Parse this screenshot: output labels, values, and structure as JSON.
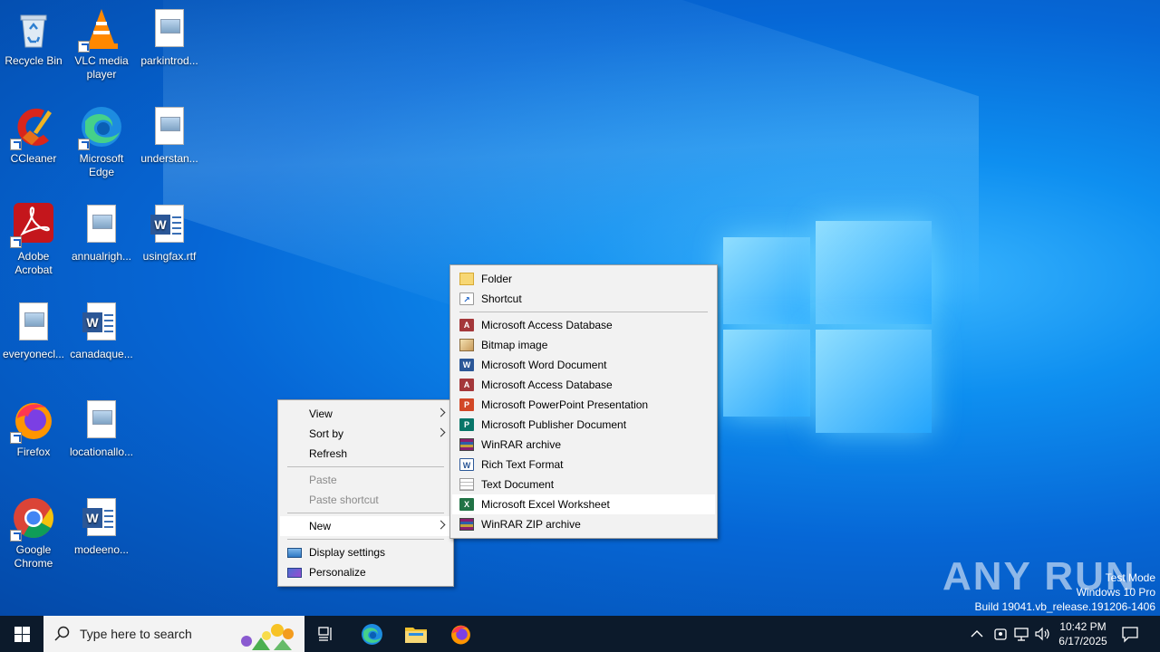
{
  "desktop_icons": [
    {
      "label": "Recycle Bin"
    },
    {
      "label": "VLC media player"
    },
    {
      "label": "parkintrod..."
    },
    {
      "label": "CCleaner"
    },
    {
      "label": "Microsoft Edge"
    },
    {
      "label": "understan..."
    },
    {
      "label": "Adobe Acrobat"
    },
    {
      "label": "annualrigh..."
    },
    {
      "label": "usingfax.rtf"
    },
    {
      "label": "everyonecl..."
    },
    {
      "label": "canadaque..."
    },
    {
      "label": "Firefox"
    },
    {
      "label": "locationallo..."
    },
    {
      "label": "Google Chrome"
    },
    {
      "label": "modeeno..."
    }
  ],
  "context_menu": {
    "items": [
      {
        "label": "View"
      },
      {
        "label": "Sort by"
      },
      {
        "label": "Refresh"
      },
      {
        "label": "Paste"
      },
      {
        "label": "Paste shortcut"
      },
      {
        "label": "New"
      },
      {
        "label": "Display settings"
      },
      {
        "label": "Personalize"
      }
    ]
  },
  "new_submenu": {
    "items": [
      {
        "label": "Folder",
        "icon": "folder-icon"
      },
      {
        "label": "Shortcut",
        "icon": "shortcut-icon"
      },
      {
        "label": "Microsoft Access Database",
        "icon": "access-icon"
      },
      {
        "label": "Bitmap image",
        "icon": "bitmap-icon"
      },
      {
        "label": "Microsoft Word Document",
        "icon": "word-icon"
      },
      {
        "label": "Microsoft Access Database",
        "icon": "access-icon"
      },
      {
        "label": "Microsoft PowerPoint Presentation",
        "icon": "powerpoint-icon"
      },
      {
        "label": "Microsoft Publisher Document",
        "icon": "publisher-icon"
      },
      {
        "label": "WinRAR archive",
        "icon": "winrar-icon"
      },
      {
        "label": "Rich Text Format",
        "icon": "wordpad-icon"
      },
      {
        "label": "Text Document",
        "icon": "text-document-icon"
      },
      {
        "label": "Microsoft Excel Worksheet",
        "icon": "excel-icon",
        "highlighted": true
      },
      {
        "label": "WinRAR ZIP archive",
        "icon": "winrar-zip-icon"
      }
    ]
  },
  "watermark": {
    "brand": "ANY RUN",
    "line1": "Test Mode",
    "line2": "Windows 10 Pro",
    "line3": "Build 19041.vb_release.191206-1406"
  },
  "taskbar": {
    "search_placeholder": "Type here to search",
    "time": "10:42 PM",
    "date": "6/17/2025"
  },
  "colors": {
    "menu_bg": "#f2f2f2",
    "taskbar_bg": "#0c1a2b",
    "wallpaper_blue": "#0667d6"
  }
}
